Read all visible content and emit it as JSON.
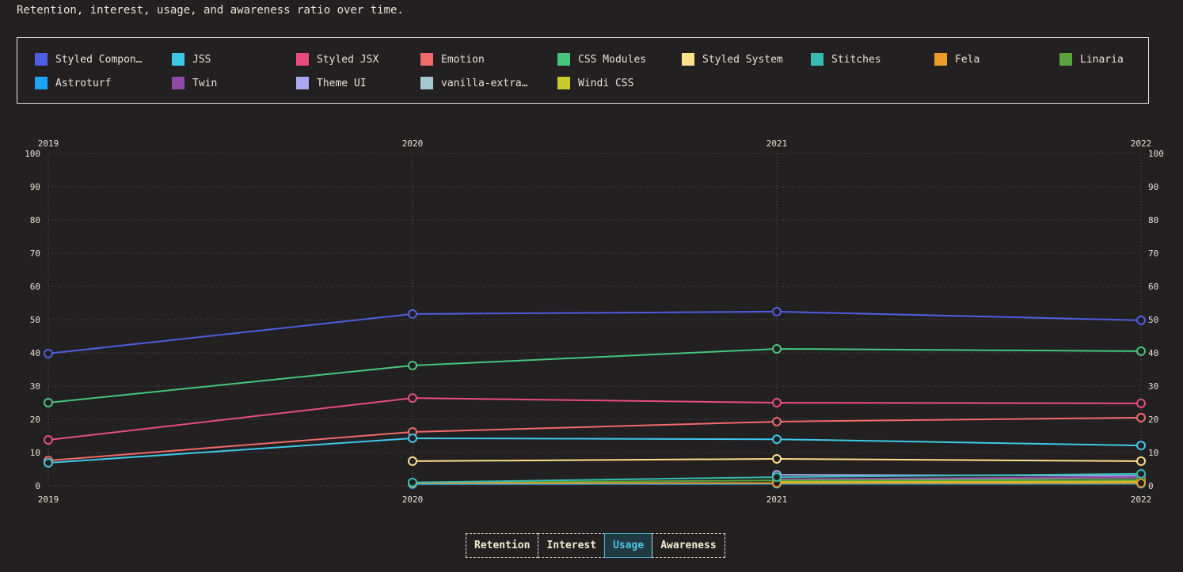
{
  "subtitle": "Retention, interest, usage, and awareness ratio over time.",
  "legend": [
    {
      "label": "Styled Compon…",
      "color": "#4d5fe0"
    },
    {
      "label": "JSS",
      "color": "#3ec8e6"
    },
    {
      "label": "Styled JSX",
      "color": "#e84c7e"
    },
    {
      "label": "Emotion",
      "color": "#f26a6a"
    },
    {
      "label": "CSS Modules",
      "color": "#45c67c"
    },
    {
      "label": "Styled System",
      "color": "#fde08a"
    },
    {
      "label": "Stitches",
      "color": "#35bcb0"
    },
    {
      "label": "Fela",
      "color": "#eb9c2a"
    },
    {
      "label": "Linaria",
      "color": "#58a33b"
    },
    {
      "label": "Astroturf",
      "color": "#1ea4f2"
    },
    {
      "label": "Twin",
      "color": "#8e4ca8"
    },
    {
      "label": "Theme UI",
      "color": "#aaa8f0"
    },
    {
      "label": "vanilla-extra…",
      "color": "#a6c8d0"
    },
    {
      "label": "Windi CSS",
      "color": "#c9ca2e"
    }
  ],
  "tabs": [
    {
      "label": "Retention",
      "active": false
    },
    {
      "label": "Interest",
      "active": false
    },
    {
      "label": "Usage",
      "active": true
    },
    {
      "label": "Awareness",
      "active": false
    }
  ],
  "chart_data": {
    "type": "line",
    "title": "",
    "xlabel": "",
    "ylabel": "",
    "x": [
      "2019",
      "2020",
      "2021",
      "2022"
    ],
    "ylim": [
      0,
      100
    ],
    "yticks": [
      0,
      10,
      20,
      30,
      40,
      50,
      60,
      70,
      80,
      90,
      100
    ],
    "grid": true,
    "legend_position": "top",
    "series": [
      {
        "name": "Styled Components",
        "color": "#4d5fe0",
        "values": [
          39.8,
          51.7,
          52.4,
          49.8
        ]
      },
      {
        "name": "JSS",
        "color": "#3ec8e6",
        "values": [
          6.9,
          14.3,
          14.0,
          12.1
        ]
      },
      {
        "name": "Styled JSX",
        "color": "#e84c7e",
        "values": [
          13.8,
          26.4,
          25.0,
          24.8
        ]
      },
      {
        "name": "Emotion",
        "color": "#f26a6a",
        "values": [
          7.6,
          16.2,
          19.3,
          20.5
        ]
      },
      {
        "name": "CSS Modules",
        "color": "#45c67c",
        "values": [
          25.0,
          36.2,
          41.2,
          40.5
        ]
      },
      {
        "name": "Styled System",
        "color": "#fde08a",
        "values": [
          null,
          7.4,
          8.1,
          7.4
        ]
      },
      {
        "name": "Stitches",
        "color": "#35bcb0",
        "values": [
          null,
          1.0,
          2.6,
          3.6
        ]
      },
      {
        "name": "Fela",
        "color": "#eb9c2a",
        "values": [
          null,
          0.8,
          0.8,
          0.8
        ]
      },
      {
        "name": "Linaria",
        "color": "#58a33b",
        "values": [
          null,
          0.9,
          1.6,
          1.8
        ]
      },
      {
        "name": "Astroturf",
        "color": "#1ea4f2",
        "values": [
          null,
          0.5,
          0.6,
          0.6
        ]
      },
      {
        "name": "Twin",
        "color": "#8e4ca8",
        "values": [
          null,
          null,
          2.0,
          2.6
        ]
      },
      {
        "name": "Theme UI",
        "color": "#aaa8f0",
        "values": [
          null,
          null,
          3.3,
          3.0
        ]
      },
      {
        "name": "vanilla-extract",
        "color": "#a6c8d0",
        "values": [
          null,
          null,
          1.8,
          2.5
        ]
      },
      {
        "name": "Windi CSS",
        "color": "#c9ca2e",
        "values": [
          null,
          null,
          1.2,
          1.3
        ]
      }
    ]
  }
}
